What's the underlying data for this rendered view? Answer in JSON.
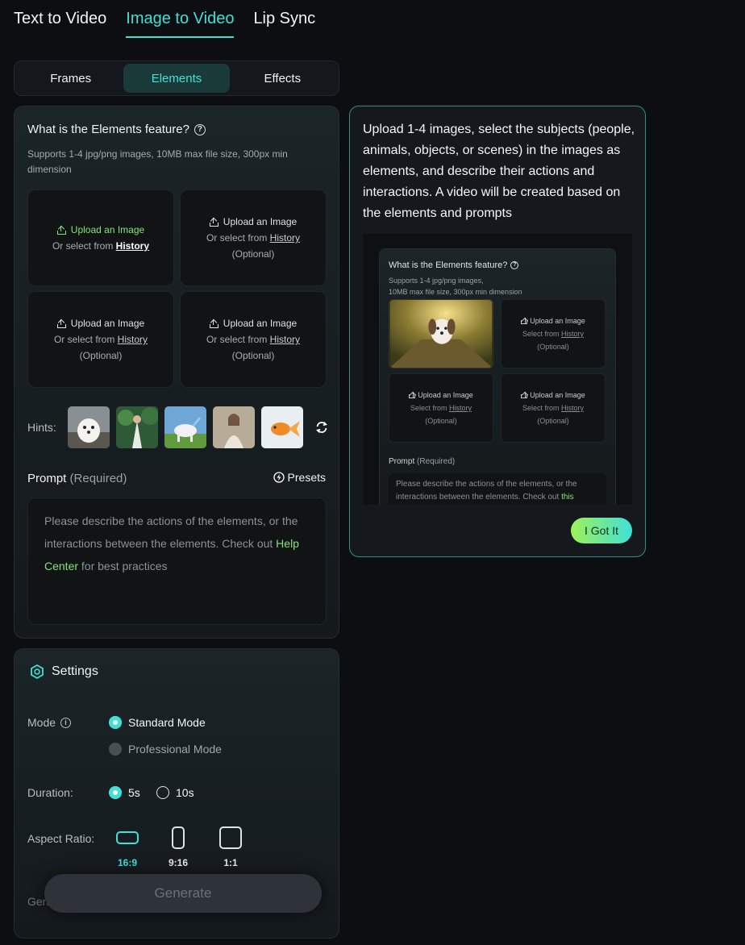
{
  "top_tabs": [
    {
      "label": "Text to Video"
    },
    {
      "label": "Image to Video"
    },
    {
      "label": "Lip Sync"
    }
  ],
  "sub_tabs": [
    {
      "label": "Frames"
    },
    {
      "label": "Elements"
    },
    {
      "label": "Effects"
    }
  ],
  "elements": {
    "title": "What is the Elements feature?",
    "subtitle": "Supports 1-4 jpg/png images, 10MB max file size, 300px min dimension",
    "upload_label": "Upload an Image",
    "select_prefix": "Or select from",
    "history_link": "History",
    "optional_label": "(Optional)",
    "hints_label": "Hints:",
    "prompt_label": "Prompt",
    "prompt_required": "(Required)",
    "presets_label": "Presets",
    "prompt_placeholder_a": "Please describe the actions of the elements, or the interactions between the elements. Check out",
    "prompt_link": "Help Center",
    "prompt_placeholder_b": "for best practices"
  },
  "settings": {
    "title": "Settings",
    "mode_label": "Mode",
    "mode_options": [
      "Standard Mode",
      "Professional Mode"
    ],
    "duration_label": "Duration:",
    "duration_options": [
      "5s",
      "10s"
    ],
    "aspect_label": "Aspect Ratio:",
    "aspect_options": [
      "16:9",
      "9:16",
      "1:1"
    ],
    "generate_label_partial": "Gen"
  },
  "generate_button": "Generate",
  "tip": {
    "text": "Upload 1-4 images, select the subjects (people, animals, objects, or scenes) in the images as elements, and describe their actions and interactions. A video will be created based on the elements and prompts",
    "preview": {
      "title": "What is the Elements feature?",
      "subtitle_1": "Supports 1-4 jpg/png images,",
      "subtitle_2": "10MB max file size, 300px min dimension",
      "upload_label": "Upload an Image",
      "select_prefix": "Select from",
      "history_link": "History",
      "optional_label": "(Optional)",
      "prompt_label": "Prompt",
      "prompt_required": "(Required)",
      "prompt_text": "Please describe the actions of the elements, or the interactions between the elements. Check out",
      "prompt_link": "this"
    },
    "got_it": "I Got It"
  },
  "colors": {
    "accent": "#3fe0d8",
    "green": "#7fe67a",
    "bg": "#0c0e12"
  }
}
